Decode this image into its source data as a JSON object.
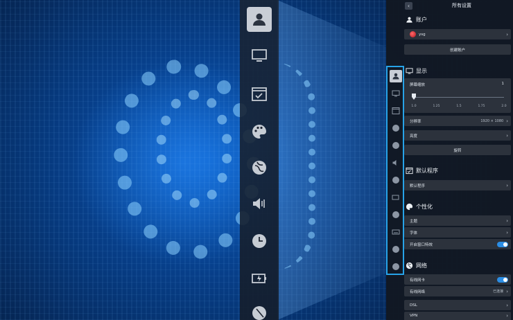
{
  "panel": {
    "title": "所有设置",
    "back_icon": "chevron-left-icon"
  },
  "account": {
    "section_title": "账户",
    "user_name": "ysg",
    "create_account_label": "创建账户"
  },
  "display": {
    "section_title": "显示",
    "scale_label": "屏幕缩放",
    "scale_value": "1",
    "scale_ticks": [
      "1.0",
      "1.25",
      "1.5",
      "1.75",
      "2.0"
    ],
    "scale_fraction": 0.0,
    "resolution_label": "分辨率",
    "resolution_value": "1920 × 1080",
    "brightness_label": "亮度",
    "rotate_label": "旋转"
  },
  "default_apps": {
    "section_title": "默认程序",
    "row_label": "默认程序"
  },
  "personalization": {
    "section_title": "个性化",
    "theme_label": "主题",
    "font_label": "字体",
    "window_effect_label": "开启窗口特效",
    "window_effect_on": true
  },
  "network": {
    "section_title": "网络",
    "wired_card_label": "有线网卡",
    "wired_card_on": true,
    "wired_network_label": "有线网络",
    "wired_network_status": "已连接",
    "dsl_label": "DSL",
    "vpn_label": "VPN"
  },
  "dock_icons": [
    "user-icon",
    "display-icon",
    "default-apps-icon",
    "palette-icon",
    "network-icon",
    "sound-icon",
    "clock-icon",
    "power-icon",
    "mouse-icon"
  ],
  "side_icons": [
    "user-icon",
    "display-icon",
    "default-apps-icon",
    "palette-icon",
    "network-icon",
    "sound-icon",
    "clock-icon",
    "power-icon",
    "mouse-icon",
    "keyboard-icon",
    "update-icon",
    "info-icon"
  ],
  "colors": {
    "accent": "#2b8de4",
    "highlight_border": "#27a3e8",
    "panel_bg": "#12182299",
    "row_bg": "#2c323c"
  }
}
